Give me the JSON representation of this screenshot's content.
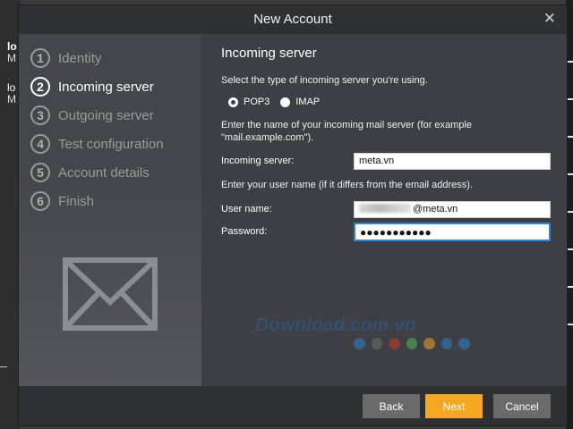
{
  "background": {
    "items": [
      {
        "title": "lo",
        "sub": "M"
      },
      {
        "title": "lo",
        "sub": "M"
      }
    ]
  },
  "dialog": {
    "title": "New Account",
    "close_glyph": "✕",
    "steps": [
      {
        "num": "1",
        "label": "Identity"
      },
      {
        "num": "2",
        "label": "Incoming server"
      },
      {
        "num": "3",
        "label": "Outgoing server"
      },
      {
        "num": "4",
        "label": "Test configuration"
      },
      {
        "num": "5",
        "label": "Account details"
      },
      {
        "num": "6",
        "label": "Finish"
      }
    ],
    "active_step": 2,
    "illustration": "envelope-icon"
  },
  "incoming": {
    "heading": "Incoming server",
    "type_prompt": "Select the type of incoming server you're using.",
    "options": {
      "pop3": "POP3",
      "imap": "IMAP"
    },
    "selected": "POP3",
    "server_prompt": "Enter the name of your incoming mail server (for example \"mail.example.com\").",
    "server_label": "Incoming server:",
    "server_value": "meta.vn",
    "user_prompt": "Enter your user name (if it differs from the email address).",
    "user_label": "User name:",
    "user_value_suffix": "@meta.vn",
    "password_label": "Password:",
    "password_value": "●●●●●●●●●●●"
  },
  "watermark": {
    "text": "Download.com.vn",
    "dot_colors": [
      "#2f7cc1",
      "#6b6b6b",
      "#c0392b",
      "#4caf50",
      "#e09a2a",
      "#2f7cc1",
      "#2f7cc1"
    ]
  },
  "footer": {
    "back_label": "Back",
    "next_label": "Next",
    "cancel_label": "Cancel"
  },
  "colors": {
    "accent": "#f5a623",
    "focus": "#2f86d9"
  }
}
